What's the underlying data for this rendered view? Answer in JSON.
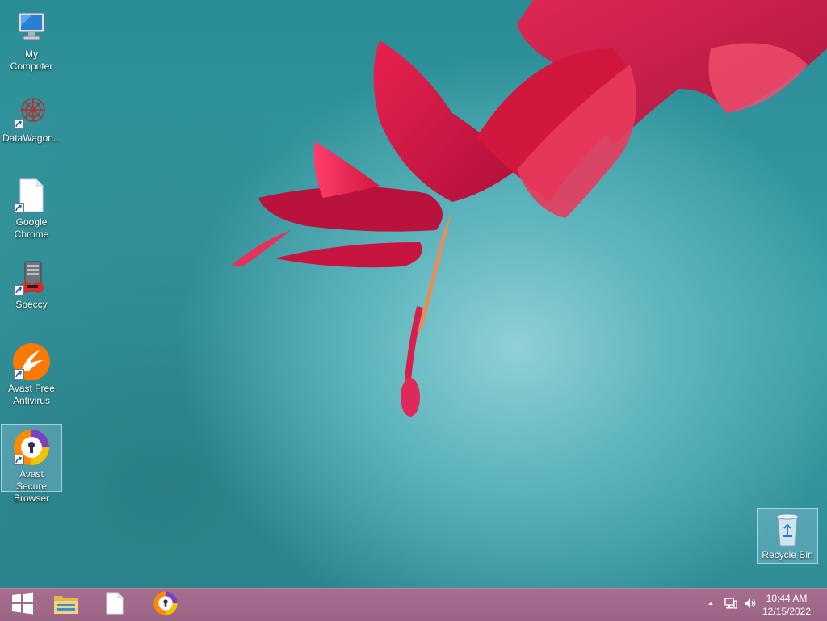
{
  "desktop": {
    "icons": [
      {
        "label": "My Computer"
      },
      {
        "label": "DataWagon..."
      },
      {
        "label": "Google Chrome"
      },
      {
        "label": "Speccy"
      },
      {
        "label": "Avast Free Antivirus"
      },
      {
        "label": "Avast Secure Browser"
      },
      {
        "label": "Recycle Bin"
      }
    ]
  },
  "taskbar": {
    "pinned": [
      {
        "icon": "windows-start-icon"
      },
      {
        "icon": "file-explorer-icon"
      },
      {
        "icon": "blank-file-icon"
      },
      {
        "icon": "avast-secure-browser-icon"
      }
    ],
    "clock": {
      "time": "10:44 AM",
      "date": "12/15/2022"
    }
  },
  "colors": {
    "accent_taskbar": "#9c6585",
    "avast_orange": "#ff7800"
  }
}
